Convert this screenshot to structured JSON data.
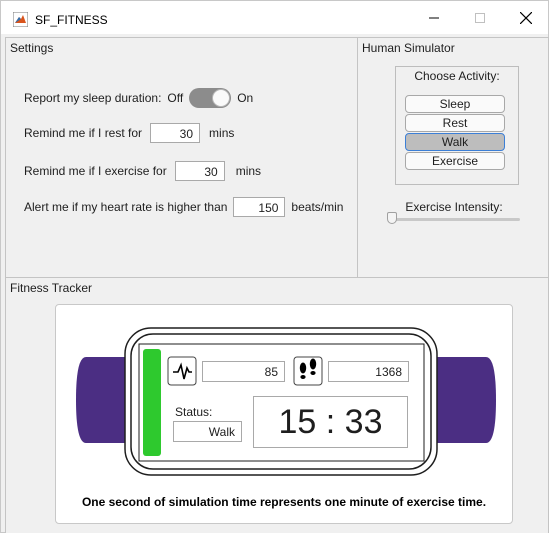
{
  "window": {
    "title": "SF_FITNESS"
  },
  "settings": {
    "title": "Settings",
    "sleep_label": "Report my sleep duration:",
    "sleep_off": "Off",
    "sleep_on": "On",
    "sleep_state": "On",
    "rest_label": "Remind me if I rest for",
    "rest_value": "30",
    "rest_unit": "mins",
    "exercise_label": "Remind me if I exercise for",
    "exercise_value": "30",
    "exercise_unit": "mins",
    "heart_label": "Alert me if my heart rate is higher than",
    "heart_value": "150",
    "heart_unit": "beats/min"
  },
  "human": {
    "title": "Human Simulator",
    "group_title": "Choose Activity:",
    "activities": [
      "Sleep",
      "Rest",
      "Walk",
      "Exercise"
    ],
    "selected": "Walk",
    "intensity_label": "Exercise Intensity:",
    "intensity_value": 0
  },
  "tracker": {
    "title": "Fitness Tracker",
    "heart_rate": "85",
    "steps": "1368",
    "status_label": "Status:",
    "status_value": "Walk",
    "clock": "15 : 33",
    "caption": "One second of simulation time represents one minute of exercise time.",
    "colors": {
      "band": "#4b2e83",
      "indicator": "#2ec92e"
    },
    "icons": [
      "heartbeat-icon",
      "footsteps-icon"
    ]
  }
}
